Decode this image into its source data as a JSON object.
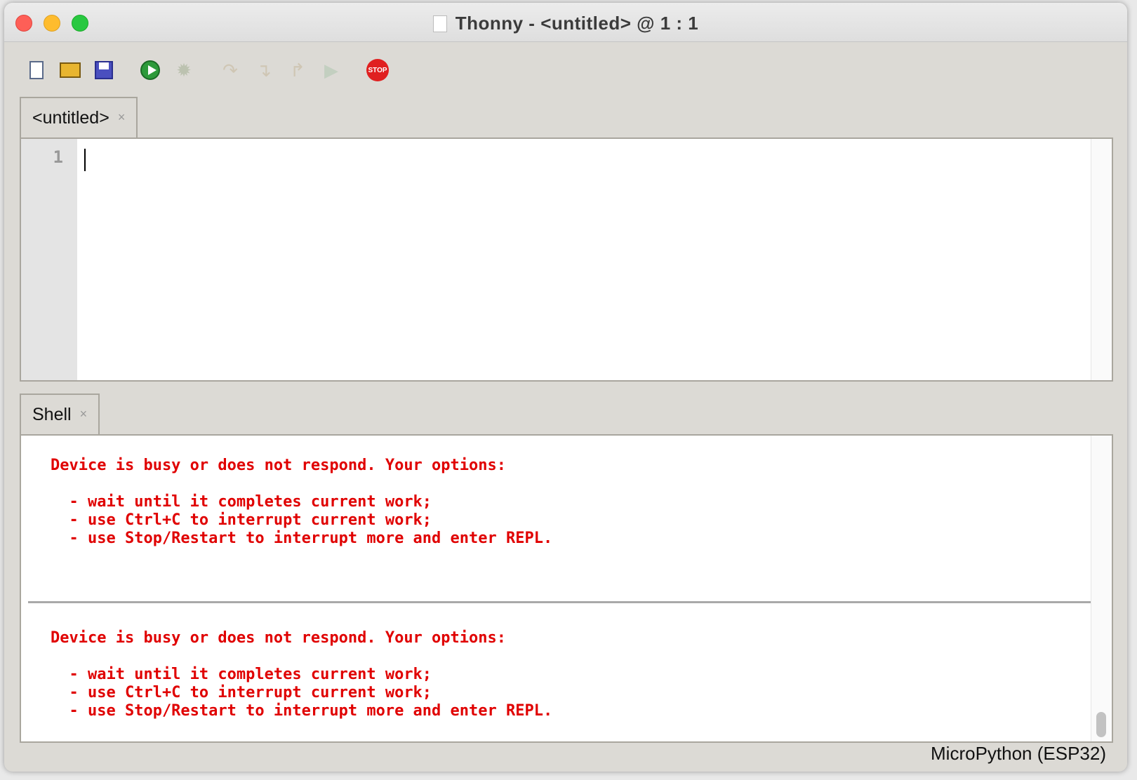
{
  "window": {
    "title": "Thonny  -  <untitled>  @  1 : 1"
  },
  "toolbar": [
    {
      "name": "new-file-icon"
    },
    {
      "name": "open-folder-icon"
    },
    {
      "name": "save-icon"
    },
    {
      "name": "run-icon"
    },
    {
      "name": "debug-icon"
    },
    {
      "name": "step-over-icon"
    },
    {
      "name": "step-into-icon"
    },
    {
      "name": "step-out-icon"
    },
    {
      "name": "resume-icon"
    },
    {
      "name": "stop-icon",
      "label": "STOP"
    }
  ],
  "editor": {
    "tab_label": "<untitled>",
    "close": "×",
    "line_numbers": [
      "1"
    ]
  },
  "shell": {
    "tab_label": "Shell",
    "close": "×",
    "blocks": [
      "Device is busy or does not respond. Your options:\n\n  - wait until it completes current work;\n  - use Ctrl+C to interrupt current work;\n  - use Stop/Restart to interrupt more and enter REPL.",
      "Device is busy or does not respond. Your options:\n\n  - wait until it completes current work;\n  - use Ctrl+C to interrupt current work;\n  - use Stop/Restart to interrupt more and enter REPL."
    ]
  },
  "status": {
    "interpreter": "MicroPython (ESP32)"
  },
  "colors": {
    "error_text": "#e00000",
    "window_bg": "#dcdad5"
  }
}
